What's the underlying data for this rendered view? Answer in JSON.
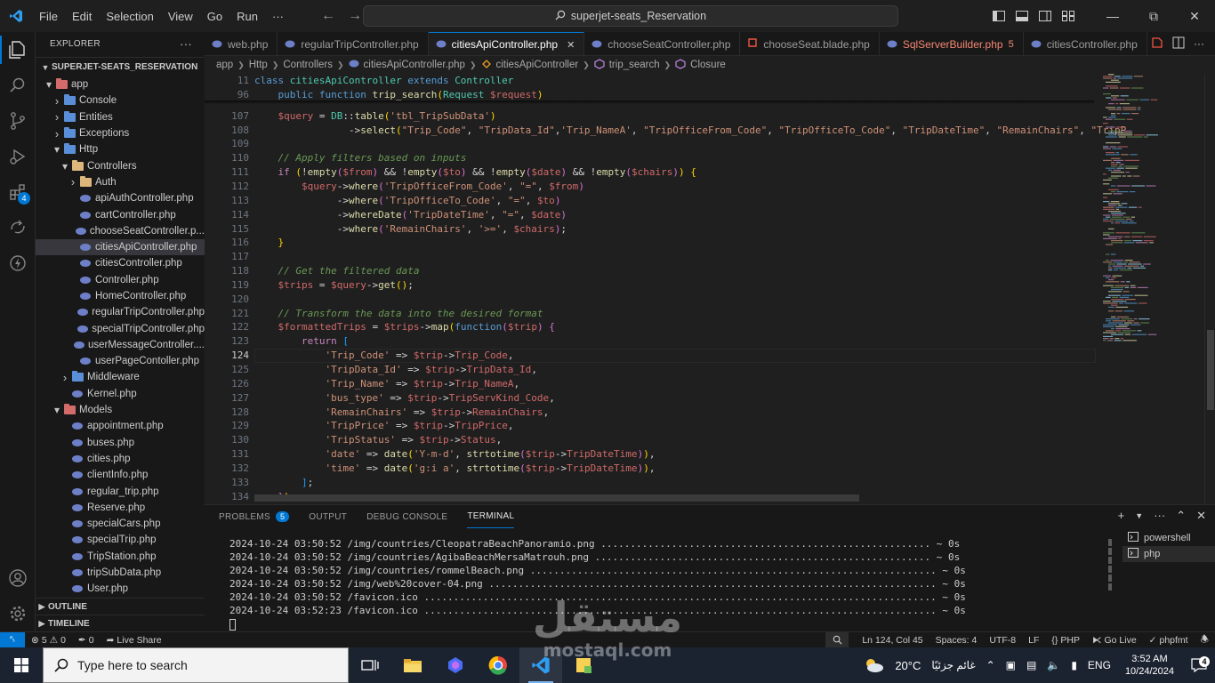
{
  "titlebar": {
    "menu": [
      "File",
      "Edit",
      "Selection",
      "View",
      "Go",
      "Run",
      "···"
    ],
    "search_text": "superjet-seats_Reservation"
  },
  "sidebar": {
    "header": "EXPLORER",
    "project": "SUPERJET-SEATS_RESERVATION",
    "tree": [
      {
        "label": "app",
        "depth": 0,
        "type": "folder-red",
        "open": true
      },
      {
        "label": "Console",
        "depth": 1,
        "type": "folder",
        "open": false
      },
      {
        "label": "Entities",
        "depth": 1,
        "type": "folder",
        "open": false
      },
      {
        "label": "Exceptions",
        "depth": 1,
        "type": "folder",
        "open": false
      },
      {
        "label": "Http",
        "depth": 1,
        "type": "folder",
        "open": true
      },
      {
        "label": "Controllers",
        "depth": 2,
        "type": "folder",
        "open": true
      },
      {
        "label": "Auth",
        "depth": 3,
        "type": "folder",
        "open": false
      },
      {
        "label": "apiAuthController.php",
        "depth": 3,
        "type": "php"
      },
      {
        "label": "cartController.php",
        "depth": 3,
        "type": "php"
      },
      {
        "label": "chooseSeatController.p...",
        "depth": 3,
        "type": "php"
      },
      {
        "label": "citiesApiController.php",
        "depth": 3,
        "type": "php",
        "selected": true
      },
      {
        "label": "citiesController.php",
        "depth": 3,
        "type": "php"
      },
      {
        "label": "Controller.php",
        "depth": 3,
        "type": "php"
      },
      {
        "label": "HomeController.php",
        "depth": 3,
        "type": "php"
      },
      {
        "label": "regularTripController.php",
        "depth": 3,
        "type": "php"
      },
      {
        "label": "specialTripController.php",
        "depth": 3,
        "type": "php"
      },
      {
        "label": "userMessageController....",
        "depth": 3,
        "type": "php"
      },
      {
        "label": "userPageContoller.php",
        "depth": 3,
        "type": "php"
      },
      {
        "label": "Middleware",
        "depth": 2,
        "type": "folder",
        "open": false
      },
      {
        "label": "Kernel.php",
        "depth": 2,
        "type": "php"
      },
      {
        "label": "Models",
        "depth": 1,
        "type": "folder-red",
        "open": true
      },
      {
        "label": "appointment.php",
        "depth": 2,
        "type": "php"
      },
      {
        "label": "buses.php",
        "depth": 2,
        "type": "php"
      },
      {
        "label": "cities.php",
        "depth": 2,
        "type": "php"
      },
      {
        "label": "clientInfo.php",
        "depth": 2,
        "type": "php"
      },
      {
        "label": "regular_trip.php",
        "depth": 2,
        "type": "php"
      },
      {
        "label": "Reserve.php",
        "depth": 2,
        "type": "php"
      },
      {
        "label": "specialCars.php",
        "depth": 2,
        "type": "php"
      },
      {
        "label": "specialTrip.php",
        "depth": 2,
        "type": "php"
      },
      {
        "label": "TripStation.php",
        "depth": 2,
        "type": "php"
      },
      {
        "label": "tripSubData.php",
        "depth": 2,
        "type": "php"
      },
      {
        "label": "User.php",
        "depth": 2,
        "type": "php"
      }
    ],
    "outline": "OUTLINE",
    "timeline": "TIMELINE"
  },
  "tabs": [
    {
      "label": "web.php",
      "active": false
    },
    {
      "label": "regularTripController.php",
      "active": false
    },
    {
      "label": "citiesApiController.php",
      "active": true
    },
    {
      "label": "chooseSeatController.php",
      "active": false
    },
    {
      "label": "chooseSeat.blade.php",
      "active": false
    },
    {
      "label": "SqlServerBuilder.php",
      "active": false,
      "warn": true,
      "count": "5"
    },
    {
      "label": "citiesController.php",
      "active": false
    }
  ],
  "breadcrumb": [
    "app",
    "Http",
    "Controllers",
    "citiesApiController.php",
    "citiesApiController",
    "trip_search",
    "Closure"
  ],
  "editor": {
    "line_numbers": [
      "11",
      "96",
      "107",
      "108",
      "109",
      "110",
      "111",
      "112",
      "113",
      "114",
      "115",
      "116",
      "117",
      "118",
      "119",
      "120",
      "121",
      "122",
      "123",
      "124",
      "125",
      "126",
      "127",
      "128",
      "129",
      "130",
      "131",
      "132",
      "133",
      "134"
    ],
    "current_line": "124",
    "lines": [
      [
        [
          "kw",
          "class "
        ],
        [
          "cls",
          "citiesApiController "
        ],
        [
          "kw",
          "extends "
        ],
        [
          "cls",
          "Controller"
        ]
      ],
      [
        [
          "t",
          "    "
        ],
        [
          "kw",
          "public function "
        ],
        [
          "fn",
          "trip_search"
        ],
        [
          "br1",
          "("
        ],
        [
          "cls",
          "Request "
        ],
        [
          "var",
          "$request"
        ],
        [
          "br1",
          ")"
        ]
      ],
      [
        [
          "t",
          "    "
        ],
        [
          "var",
          "$query"
        ],
        [
          "op",
          " = "
        ],
        [
          "cls",
          "DB"
        ],
        [
          "op",
          "::"
        ],
        [
          "fn",
          "table"
        ],
        [
          "br1",
          "("
        ],
        [
          "str",
          "'tbl_TripSubData'"
        ],
        [
          "br1",
          ")"
        ]
      ],
      [
        [
          "t",
          "                "
        ],
        [
          "op",
          "->"
        ],
        [
          "fn",
          "select"
        ],
        [
          "br1",
          "("
        ],
        [
          "str",
          "\"Trip_Code\""
        ],
        [
          "op",
          ", "
        ],
        [
          "str",
          "\"TripData_Id\""
        ],
        [
          "op",
          ","
        ],
        [
          "str",
          "'Trip_NameA'"
        ],
        [
          "op",
          ", "
        ],
        [
          "str",
          "\"TripOfficeFrom_Code\""
        ],
        [
          "op",
          ", "
        ],
        [
          "str",
          "\"TripOfficeTo_Code\""
        ],
        [
          "op",
          ", "
        ],
        [
          "str",
          "\"TripDateTime\""
        ],
        [
          "op",
          ", "
        ],
        [
          "str",
          "\"RemainChairs\""
        ],
        [
          "op",
          ", "
        ],
        [
          "str",
          "\"TripP"
        ]
      ],
      [],
      [
        [
          "t",
          "    "
        ],
        [
          "cm",
          "// Apply filters based on inputs"
        ]
      ],
      [
        [
          "t",
          "    "
        ],
        [
          "kwc",
          "if "
        ],
        [
          "br1",
          "("
        ],
        [
          "op",
          "!"
        ],
        [
          "fn",
          "empty"
        ],
        [
          "br2",
          "("
        ],
        [
          "var",
          "$from"
        ],
        [
          "br2",
          ")"
        ],
        [
          "op",
          " && !"
        ],
        [
          "fn",
          "empty"
        ],
        [
          "br2",
          "("
        ],
        [
          "var",
          "$to"
        ],
        [
          "br2",
          ")"
        ],
        [
          "op",
          " && !"
        ],
        [
          "fn",
          "empty"
        ],
        [
          "br2",
          "("
        ],
        [
          "var",
          "$date"
        ],
        [
          "br2",
          ")"
        ],
        [
          "op",
          " && !"
        ],
        [
          "fn",
          "empty"
        ],
        [
          "br2",
          "("
        ],
        [
          "var",
          "$chairs"
        ],
        [
          "br2",
          ")"
        ],
        [
          "br1",
          ")"
        ],
        [
          "op",
          " "
        ],
        [
          "br1",
          "{"
        ]
      ],
      [
        [
          "t",
          "        "
        ],
        [
          "var",
          "$query"
        ],
        [
          "op",
          "->"
        ],
        [
          "fn",
          "where"
        ],
        [
          "br2",
          "("
        ],
        [
          "str",
          "'TripOfficeFrom_Code'"
        ],
        [
          "op",
          ", "
        ],
        [
          "str",
          "\"=\""
        ],
        [
          "op",
          ", "
        ],
        [
          "var",
          "$from"
        ],
        [
          "br2",
          ")"
        ]
      ],
      [
        [
          "t",
          "              "
        ],
        [
          "op",
          "->"
        ],
        [
          "fn",
          "where"
        ],
        [
          "br2",
          "("
        ],
        [
          "str",
          "'TripOfficeTo_Code'"
        ],
        [
          "op",
          ", "
        ],
        [
          "str",
          "\"=\""
        ],
        [
          "op",
          ", "
        ],
        [
          "var",
          "$to"
        ],
        [
          "br2",
          ")"
        ]
      ],
      [
        [
          "t",
          "              "
        ],
        [
          "op",
          "->"
        ],
        [
          "fn",
          "whereDate"
        ],
        [
          "br2",
          "("
        ],
        [
          "str",
          "'TripDateTime'"
        ],
        [
          "op",
          ", "
        ],
        [
          "str",
          "\"=\""
        ],
        [
          "op",
          ", "
        ],
        [
          "var",
          "$date"
        ],
        [
          "br2",
          ")"
        ]
      ],
      [
        [
          "t",
          "              "
        ],
        [
          "op",
          "->"
        ],
        [
          "fn",
          "where"
        ],
        [
          "br2",
          "("
        ],
        [
          "str",
          "'RemainChairs'"
        ],
        [
          "op",
          ", "
        ],
        [
          "str",
          "'>='"
        ],
        [
          "op",
          ", "
        ],
        [
          "var",
          "$chairs"
        ],
        [
          "br2",
          ")"
        ],
        [
          "op",
          ";"
        ]
      ],
      [
        [
          "t",
          "    "
        ],
        [
          "br1",
          "}"
        ]
      ],
      [],
      [
        [
          "t",
          "    "
        ],
        [
          "cm",
          "// Get the filtered data"
        ]
      ],
      [
        [
          "t",
          "    "
        ],
        [
          "var",
          "$trips"
        ],
        [
          "op",
          " = "
        ],
        [
          "var",
          "$query"
        ],
        [
          "op",
          "->"
        ],
        [
          "fn",
          "get"
        ],
        [
          "br1",
          "()"
        ],
        [
          "op",
          ";"
        ]
      ],
      [],
      [
        [
          "t",
          "    "
        ],
        [
          "cm",
          "// Transform the data into the desired format"
        ]
      ],
      [
        [
          "t",
          "    "
        ],
        [
          "var",
          "$formattedTrips"
        ],
        [
          "op",
          " = "
        ],
        [
          "var",
          "$trips"
        ],
        [
          "op",
          "->"
        ],
        [
          "fn",
          "map"
        ],
        [
          "br1",
          "("
        ],
        [
          "kw",
          "function"
        ],
        [
          "br2",
          "("
        ],
        [
          "var",
          "$trip"
        ],
        [
          "br2",
          ")"
        ],
        [
          "op",
          " "
        ],
        [
          "br2",
          "{"
        ]
      ],
      [
        [
          "t",
          "        "
        ],
        [
          "kwc",
          "return "
        ],
        [
          "br3",
          "["
        ]
      ],
      [
        [
          "t",
          "            "
        ],
        [
          "str",
          "'Trip_Code'"
        ],
        [
          "op",
          " => "
        ],
        [
          "var",
          "$trip"
        ],
        [
          "op",
          "->"
        ],
        [
          "var",
          "Trip_Code"
        ],
        [
          "op",
          ","
        ]
      ],
      [
        [
          "t",
          "            "
        ],
        [
          "str",
          "'TripData_Id'"
        ],
        [
          "op",
          " => "
        ],
        [
          "var",
          "$trip"
        ],
        [
          "op",
          "->"
        ],
        [
          "var",
          "TripData_Id"
        ],
        [
          "op",
          ","
        ]
      ],
      [
        [
          "t",
          "            "
        ],
        [
          "str",
          "'Trip_Name'"
        ],
        [
          "op",
          " => "
        ],
        [
          "var",
          "$trip"
        ],
        [
          "op",
          "->"
        ],
        [
          "var",
          "Trip_NameA"
        ],
        [
          "op",
          ","
        ]
      ],
      [
        [
          "t",
          "            "
        ],
        [
          "str",
          "'bus_type'"
        ],
        [
          "op",
          " => "
        ],
        [
          "var",
          "$trip"
        ],
        [
          "op",
          "->"
        ],
        [
          "var",
          "TripServKind_Code"
        ],
        [
          "op",
          ","
        ]
      ],
      [
        [
          "t",
          "            "
        ],
        [
          "str",
          "'RemainChairs'"
        ],
        [
          "op",
          " => "
        ],
        [
          "var",
          "$trip"
        ],
        [
          "op",
          "->"
        ],
        [
          "var",
          "RemainChairs"
        ],
        [
          "op",
          ","
        ]
      ],
      [
        [
          "t",
          "            "
        ],
        [
          "str",
          "'TripPrice'"
        ],
        [
          "op",
          " => "
        ],
        [
          "var",
          "$trip"
        ],
        [
          "op",
          "->"
        ],
        [
          "var",
          "TripPrice"
        ],
        [
          "op",
          ","
        ]
      ],
      [
        [
          "t",
          "            "
        ],
        [
          "str",
          "'TripStatus'"
        ],
        [
          "op",
          " => "
        ],
        [
          "var",
          "$trip"
        ],
        [
          "op",
          "->"
        ],
        [
          "var",
          "Status"
        ],
        [
          "op",
          ","
        ]
      ],
      [
        [
          "t",
          "            "
        ],
        [
          "str",
          "'date'"
        ],
        [
          "op",
          " => "
        ],
        [
          "fn",
          "date"
        ],
        [
          "br1",
          "("
        ],
        [
          "str",
          "'Y-m-d'"
        ],
        [
          "op",
          ", "
        ],
        [
          "fn",
          "strtotime"
        ],
        [
          "br2",
          "("
        ],
        [
          "var",
          "$trip"
        ],
        [
          "op",
          "->"
        ],
        [
          "var",
          "TripDateTime"
        ],
        [
          "br2",
          ")"
        ],
        [
          "br1",
          ")"
        ],
        [
          "op",
          ","
        ]
      ],
      [
        [
          "t",
          "            "
        ],
        [
          "str",
          "'time'"
        ],
        [
          "op",
          " => "
        ],
        [
          "fn",
          "date"
        ],
        [
          "br1",
          "("
        ],
        [
          "str",
          "'g:i a'"
        ],
        [
          "op",
          ", "
        ],
        [
          "fn",
          "strtotime"
        ],
        [
          "br2",
          "("
        ],
        [
          "var",
          "$trip"
        ],
        [
          "op",
          "->"
        ],
        [
          "var",
          "TripDateTime"
        ],
        [
          "br2",
          ")"
        ],
        [
          "br1",
          ")"
        ],
        [
          "op",
          ","
        ]
      ],
      [
        [
          "t",
          "        "
        ],
        [
          "br3",
          "]"
        ],
        [
          "op",
          ";"
        ]
      ],
      [
        [
          "t",
          "    "
        ],
        [
          "br2",
          "}"
        ],
        [
          "br1",
          ")"
        ],
        [
          "op",
          ";"
        ]
      ]
    ]
  },
  "panel": {
    "tabs": [
      "PROBLEMS",
      "OUTPUT",
      "DEBUG CONSOLE",
      "TERMINAL"
    ],
    "problems_count": "5",
    "terminal_lines": [
      {
        "text": "2024-10-24 03:50:52 /img/countries/CleopatraBeachPanoramio.png ........................................................ ~ 0s"
      },
      {
        "text": "2024-10-24 03:50:52 /img/countries/AgibaBeachMersaMatrouh.png ......................................................... ~ 0s"
      },
      {
        "text": "2024-10-24 03:50:52 /img/countries/rommelBeach.png ..................................................................... ~ 0s"
      },
      {
        "text": "2024-10-24 03:50:52 /img/web%20cover-04.png ............................................................................ ~ 0s"
      },
      {
        "text": "2024-10-24 03:50:52 /favicon.ico ....................................................................................... ~ 0s"
      },
      {
        "text": "2024-10-24 03:52:23 /favicon.ico ....................................................................................... ~ 0s"
      }
    ],
    "terminal_list": [
      "powershell",
      "php"
    ]
  },
  "statusbar": {
    "problems": "5",
    "warnings": "0",
    "ports": "0",
    "live_share": "Live Share",
    "position": "Ln 124, Col 45",
    "spaces": "Spaces: 4",
    "encoding": "UTF-8",
    "eol": "LF",
    "language": "PHP",
    "go_live": "Go Live",
    "formatter": "phpfmt"
  },
  "taskbar": {
    "search_placeholder": "Type here to search",
    "temperature": "20°C",
    "weather": "غائم جزئيًا",
    "lang": "ENG",
    "time": "3:52 AM",
    "date": "10/24/2024",
    "notifications": "4"
  },
  "watermark": {
    "arabic": "مستقل",
    "latin": "mostaql.com"
  },
  "colors": {
    "accent": "#0078d4",
    "editor_bg": "#1f1f1f",
    "sidebar_bg": "#181818"
  }
}
